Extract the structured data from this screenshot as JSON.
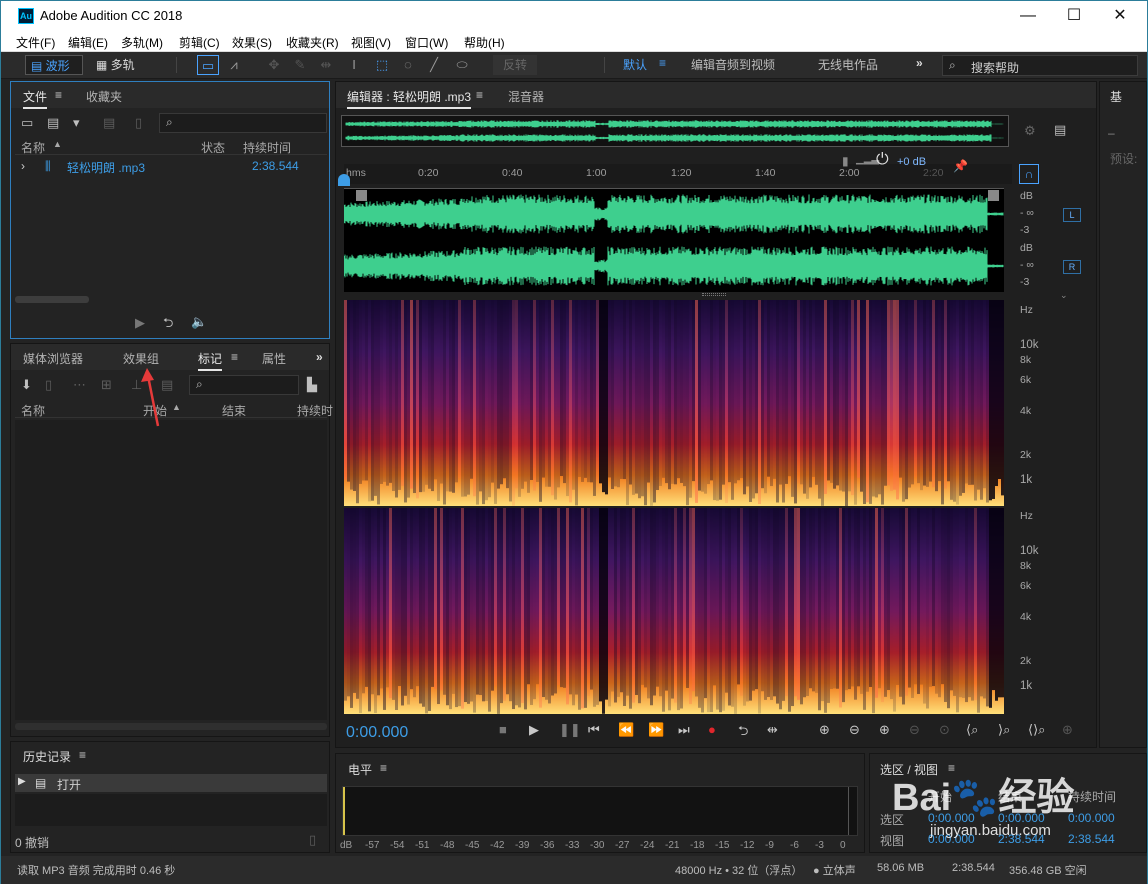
{
  "window": {
    "title": "Adobe Audition CC 2018",
    "logo_text": "Au",
    "controls": [
      "—",
      "☐",
      "✕"
    ]
  },
  "menu": [
    "文件(F)",
    "编辑(E)",
    "多轨(M)",
    "剪辑(C)",
    "效果(S)",
    "收藏夹(R)",
    "视图(V)",
    "窗口(W)",
    "帮助(H)"
  ],
  "toolbar": {
    "mode_waveform": "波形",
    "mode_multitrack": "多轨",
    "reverse": "反转",
    "workspaces": [
      "默认",
      "编辑音频到视频",
      "无线电作品"
    ],
    "workspace_menu_icon": "≡",
    "more": "»",
    "search_placeholder": "搜索帮助"
  },
  "files_panel": {
    "tabs": [
      "文件",
      "收藏夹"
    ],
    "columns": {
      "name": "名称",
      "status": "状态",
      "duration": "持续时间"
    },
    "files": [
      {
        "name": "轻松明朗 .mp3",
        "duration": "2:38.544"
      }
    ]
  },
  "markers_panel": {
    "tabs": [
      "媒体浏览器",
      "效果组",
      "标记",
      "属性"
    ],
    "more": "»",
    "columns": {
      "name": "名称",
      "start": "开始",
      "end": "结束",
      "duration": "持续时"
    }
  },
  "history_panel": {
    "title": "历史记录",
    "items": [
      "打开"
    ],
    "undo_count": "0 撤销"
  },
  "editor": {
    "tabs": [
      "编辑器 : 轻松明朗 .mp3",
      "混音器"
    ],
    "ruler_unit": "hms",
    "ruler_ticks": [
      "0:20",
      "0:40",
      "1:00",
      "1:20",
      "1:40",
      "2:00",
      "2:20"
    ],
    "volume": "+0 dB",
    "db_labels": [
      "dB",
      "- ∞",
      "-3"
    ],
    "channel_left": "L",
    "channel_right": "R",
    "freq_labels": [
      "Hz",
      "10k",
      "8k",
      "6k",
      "4k",
      "2k",
      "1k"
    ],
    "time_display": "0:00.000",
    "wave_color": "#3ecf8e"
  },
  "level_panel": {
    "title": "电平",
    "scale": [
      "dB",
      "-57",
      "-54",
      "-51",
      "-48",
      "-45",
      "-42",
      "-39",
      "-36",
      "-33",
      "-30",
      "-27",
      "-24",
      "-21",
      "-18",
      "-15",
      "-12",
      "-9",
      "-6",
      "-3",
      "0"
    ]
  },
  "selection_panel": {
    "title": "选区 / 视图",
    "headers": [
      "开始",
      "结束",
      "持续时间"
    ],
    "rows": [
      {
        "label": "选区",
        "values": [
          "0:00.000",
          "0:00.000",
          "0:00.000"
        ]
      },
      {
        "label": "视图",
        "values": [
          "0:00.000",
          "2:38.544",
          "2:38.544"
        ]
      }
    ]
  },
  "right_panel": {
    "title": "基",
    "preset": "预设:"
  },
  "status": {
    "message": "读取 MP3 音频 完成用时 0.46 秒",
    "format": "48000 Hz • 32 位（浮点）",
    "channels": "● 立体声",
    "size": "58.06 MB",
    "duration": "2:38.544",
    "free": "356.48 GB 空闲"
  },
  "watermark": {
    "text": "Bai🐾经验",
    "url": "jingyan.baidu.com"
  }
}
